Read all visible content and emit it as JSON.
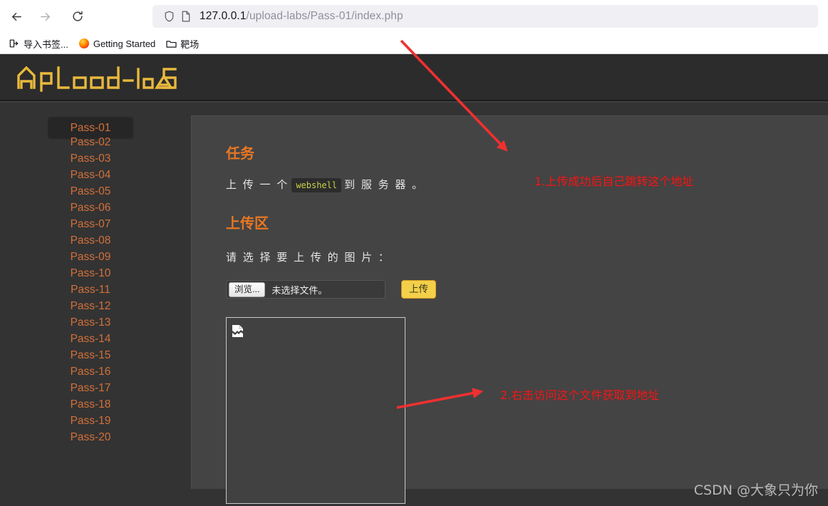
{
  "browser": {
    "back_label": "back-arrow",
    "forward_label": "forward-arrow",
    "reload_label": "reload",
    "url_host": "127.0.0.1",
    "url_path": "/upload-labs/Pass-01/index.php",
    "bookmarks": [
      {
        "label": "导入书签...",
        "icon": "import-bookmarks-icon"
      },
      {
        "label": "Getting Started",
        "icon": "firefox-icon"
      },
      {
        "label": "靶场",
        "icon": "folder-icon"
      }
    ]
  },
  "site": {
    "logo_text": "upLoad-labs"
  },
  "sidebar": {
    "items": [
      {
        "label": "Pass-01",
        "active": true
      },
      {
        "label": "Pass-02",
        "active": false
      },
      {
        "label": "Pass-03",
        "active": false
      },
      {
        "label": "Pass-04",
        "active": false
      },
      {
        "label": "Pass-05",
        "active": false
      },
      {
        "label": "Pass-06",
        "active": false
      },
      {
        "label": "Pass-07",
        "active": false
      },
      {
        "label": "Pass-08",
        "active": false
      },
      {
        "label": "Pass-09",
        "active": false
      },
      {
        "label": "Pass-10",
        "active": false
      },
      {
        "label": "Pass-11",
        "active": false
      },
      {
        "label": "Pass-12",
        "active": false
      },
      {
        "label": "Pass-13",
        "active": false
      },
      {
        "label": "Pass-14",
        "active": false
      },
      {
        "label": "Pass-15",
        "active": false
      },
      {
        "label": "Pass-16",
        "active": false
      },
      {
        "label": "Pass-17",
        "active": false
      },
      {
        "label": "Pass-18",
        "active": false
      },
      {
        "label": "Pass-19",
        "active": false
      },
      {
        "label": "Pass-20",
        "active": false
      }
    ]
  },
  "main": {
    "task_title": "任务",
    "task_text_before": "上 传 一 个",
    "task_code": "webshell",
    "task_text_after": "到 服 务 器 。",
    "upload_title": "上传区",
    "upload_prompt": "请 选 择 要 上 传 的 图 片 ：",
    "browse_button": "浏览...",
    "file_name": "未选择文件。",
    "submit_button": "上传",
    "preview_icon": "broken-image-icon"
  },
  "annotations": [
    {
      "text": "1.上传成功后自己跳转这个地址",
      "color": "#e02020"
    },
    {
      "text": "2.右击访问这个文件获取到地址",
      "color": "#e02020"
    }
  ],
  "watermark": "CSDN @大象只为你",
  "colors": {
    "accent_orange": "#e87722",
    "link_orange": "#d2703a",
    "logo_gold": "#e8b93c",
    "submit_yellow": "#f4d04a",
    "annotation_red": "#e02020",
    "page_bg": "#333333",
    "panel_bg": "#444444",
    "header_bg": "#2c2c2c"
  }
}
